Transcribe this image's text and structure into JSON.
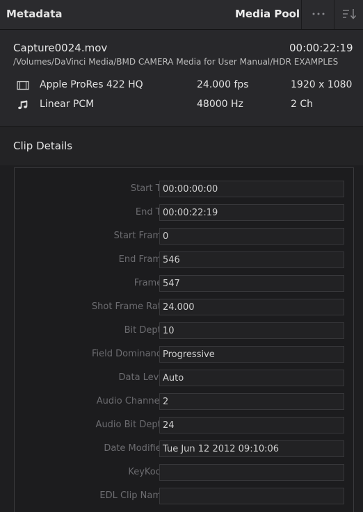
{
  "header": {
    "title": "Metadata",
    "panel_button": "Media Pool",
    "more_icon": "more-horizontal-icon",
    "sort_icon": "sort-icon"
  },
  "file": {
    "name": "Capture0024.mov",
    "duration": "00:00:22:19",
    "path": "/Volumes/DaVinci Media/BMD CAMERA Media for User Manual/HDR EXAMPLES",
    "video": {
      "icon": "film-icon",
      "codec": "Apple ProRes 422 HQ",
      "rate": "24.000 fps",
      "resolution": "1920 x 1080"
    },
    "audio": {
      "icon": "music-note-icon",
      "codec": "Linear PCM",
      "rate": "48000 Hz",
      "channels": "2 Ch"
    }
  },
  "section": {
    "title": "Clip Details"
  },
  "fields": [
    {
      "label": "Start TC",
      "value": "00:00:00:00"
    },
    {
      "label": "End TC",
      "value": "00:00:22:19"
    },
    {
      "label": "Start Frame",
      "value": "0"
    },
    {
      "label": "End Frame",
      "value": "546"
    },
    {
      "label": "Frames",
      "value": "547"
    },
    {
      "label": "Shot Frame Rate",
      "value": "24.000"
    },
    {
      "label": "Bit Depth",
      "value": "10"
    },
    {
      "label": "Field Dominance",
      "value": "Progressive"
    },
    {
      "label": "Data Level",
      "value": "Auto"
    },
    {
      "label": "Audio Channels",
      "value": "2"
    },
    {
      "label": "Audio Bit Depth",
      "value": "24"
    },
    {
      "label": "Date Modified",
      "value": "Tue Jun 12 2012 09:10:06"
    },
    {
      "label": "KeyKode",
      "value": ""
    },
    {
      "label": "EDL Clip Name",
      "value": ""
    }
  ],
  "colors": {
    "panel_bg": "#1e1e20",
    "header_bg": "#2b2b2e",
    "label_text": "#6c6c70",
    "value_text": "#cfcfcf"
  }
}
